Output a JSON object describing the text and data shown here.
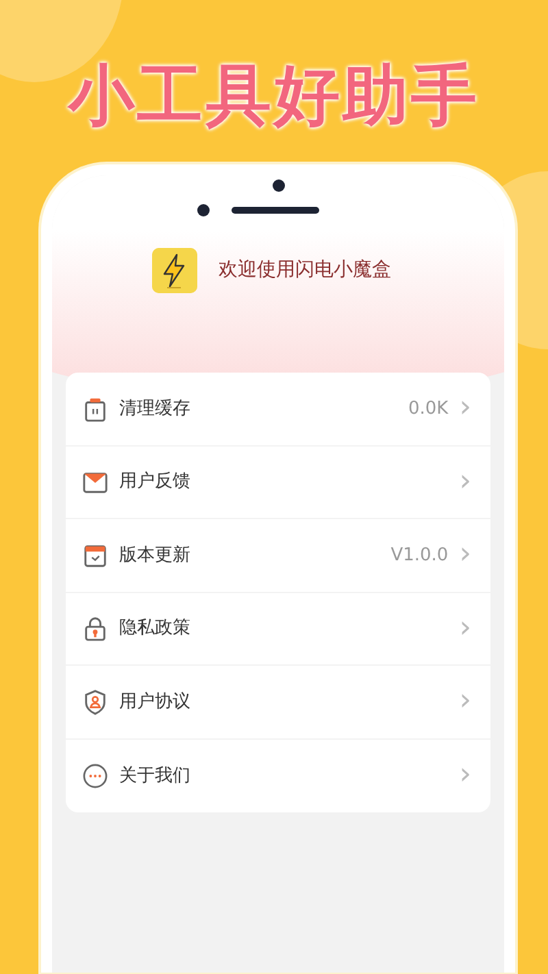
{
  "headline": "小工具好助手",
  "app": {
    "welcome": "欢迎使用闪电小魔盒"
  },
  "menu": [
    {
      "kind": "trash",
      "label": "清理缓存",
      "value": "0.0K",
      "chevron": "›"
    },
    {
      "kind": "mail",
      "label": "用户反馈",
      "chevron": "›"
    },
    {
      "kind": "calendar",
      "label": "版本更新",
      "value": "V1.0.0",
      "chevron": "›"
    },
    {
      "kind": "lock",
      "label": "隐私政策",
      "chevron": "›"
    },
    {
      "kind": "shield",
      "label": "用户协议",
      "chevron": "›"
    },
    {
      "kind": "more",
      "label": "关于我们",
      "chevron": "›"
    }
  ]
}
